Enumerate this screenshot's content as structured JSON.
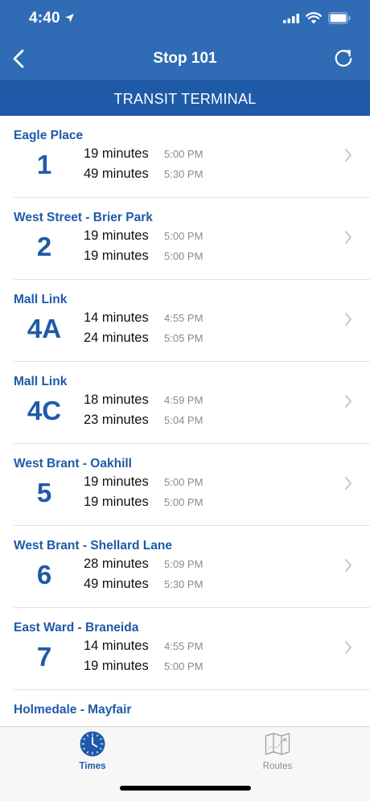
{
  "status_bar": {
    "time": "4:40"
  },
  "nav": {
    "title": "Stop 101"
  },
  "banner": {
    "text": "TRANSIT TERMINAL"
  },
  "routes": [
    {
      "name": "Eagle Place",
      "number": "1",
      "arrivals": [
        {
          "minutes": "19 minutes",
          "time": "5:00 PM"
        },
        {
          "minutes": "49 minutes",
          "time": "5:30 PM"
        }
      ]
    },
    {
      "name": "West Street - Brier Park",
      "number": "2",
      "arrivals": [
        {
          "minutes": "19 minutes",
          "time": "5:00 PM"
        },
        {
          "minutes": "19 minutes",
          "time": "5:00 PM"
        }
      ]
    },
    {
      "name": "Mall Link",
      "number": "4A",
      "arrivals": [
        {
          "minutes": "14 minutes",
          "time": "4:55 PM"
        },
        {
          "minutes": "24 minutes",
          "time": "5:05 PM"
        }
      ]
    },
    {
      "name": "Mall Link",
      "number": "4C",
      "arrivals": [
        {
          "minutes": "18 minutes",
          "time": "4:59 PM"
        },
        {
          "minutes": "23 minutes",
          "time": "5:04 PM"
        }
      ]
    },
    {
      "name": "West Brant - Oakhill",
      "number": "5",
      "arrivals": [
        {
          "minutes": "19 minutes",
          "time": "5:00 PM"
        },
        {
          "minutes": "19 minutes",
          "time": "5:00 PM"
        }
      ]
    },
    {
      "name": "West Brant - Shellard Lane",
      "number": "6",
      "arrivals": [
        {
          "minutes": "28 minutes",
          "time": "5:09 PM"
        },
        {
          "minutes": "49 minutes",
          "time": "5:30 PM"
        }
      ]
    },
    {
      "name": "East Ward - Braneida",
      "number": "7",
      "arrivals": [
        {
          "minutes": "14 minutes",
          "time": "4:55 PM"
        },
        {
          "minutes": "19 minutes",
          "time": "5:00 PM"
        }
      ]
    },
    {
      "name": "Holmedale - Mayfair",
      "number": "",
      "arrivals": []
    }
  ],
  "tabs": [
    {
      "label": "Times",
      "icon": "clock-icon",
      "active": true
    },
    {
      "label": "Routes",
      "icon": "map-icon",
      "active": false
    }
  ],
  "colors": {
    "nav": "#2f6cb5",
    "banner": "#1f5aa8",
    "accent": "#1f5aa8"
  }
}
